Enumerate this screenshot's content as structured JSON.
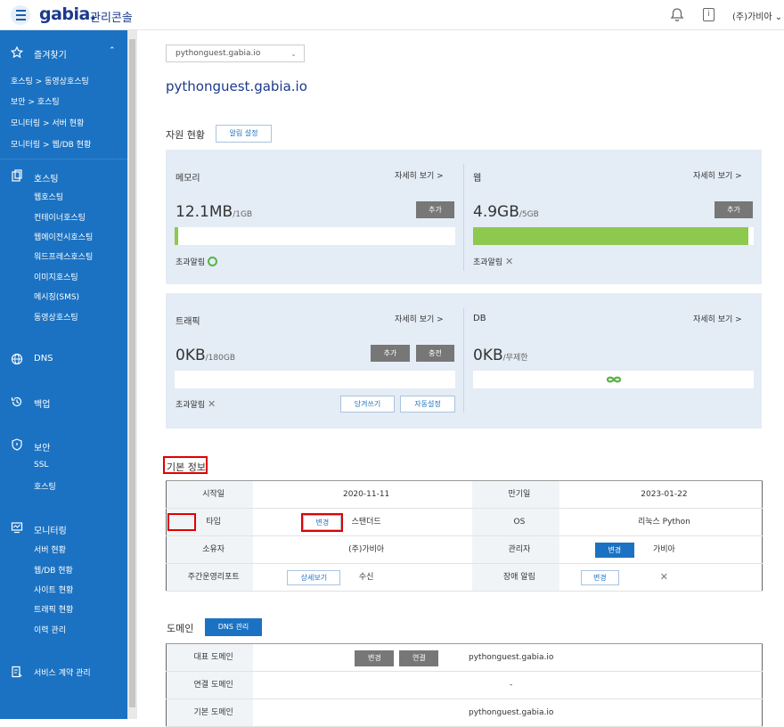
{
  "header": {
    "logo": "gabia.",
    "console_label": "관리콘솔",
    "user_name": "(주)가비아"
  },
  "sidebar": {
    "favorites": {
      "title": "즐겨찾기",
      "items": [
        "호스팅 > 동영상호스팅",
        "보안 > 호스팅",
        "모니터링 > 서버 현황",
        "모니터링 > 웹/DB 현황"
      ]
    },
    "hosting": {
      "title": "호스팅",
      "items": [
        "웹호스팅",
        "컨테이너호스팅",
        "웹에이전시호스팅",
        "워드프레스호스팅",
        "이미지호스팅",
        "메시징(SMS)",
        "동영상호스팅"
      ]
    },
    "dns": {
      "title": "DNS"
    },
    "backup": {
      "title": "백업"
    },
    "security": {
      "title": "보안",
      "items": [
        "SSL",
        "호스팅"
      ]
    },
    "monitoring": {
      "title": "모니터링",
      "items": [
        "서버 현황",
        "웹/DB 현황",
        "사이트 현황",
        "트래픽 현황",
        "이력 관리"
      ]
    },
    "contract": {
      "title": "서비스 계약 관리"
    }
  },
  "main": {
    "domain_select_value": "pythonguest.gabia.io",
    "domain_title": "pythonguest.gabia.io",
    "resources": {
      "title": "자원 현황",
      "alert_setting_button": "알림 설정",
      "detail_link": "자세히 보기 >",
      "alert_label": "초과알림",
      "memory": {
        "title": "메모리",
        "value": "12.1MB",
        "limit": "/1GB",
        "add": "추가",
        "usage_fraction": 0.012,
        "alert": "on"
      },
      "web": {
        "title": "웹",
        "value": "4.9GB",
        "limit": "/5GB",
        "add": "추가",
        "usage_fraction": 0.98,
        "alert": "off"
      },
      "traffic": {
        "title": "트래픽",
        "value": "0KB",
        "limit": "/180GB",
        "add": "추가",
        "charge": "충전",
        "usage_fraction": 0,
        "alert": "off",
        "pull_button": "당겨쓰기",
        "auto_button": "자동설정"
      },
      "db": {
        "title": "DB",
        "value": "0KB",
        "limit": "/무제한"
      }
    },
    "basic_info": {
      "title": "기본 정보",
      "rows": [
        {
          "l1": "시작일",
          "v1": "2020-11-11",
          "l2": "만기일",
          "v2": "2023-01-22"
        },
        {
          "l1": "타입",
          "v1": "스탠더드",
          "b1": "변경",
          "l2": "OS",
          "v2": "리눅스 Python"
        },
        {
          "l1": "소유자",
          "v1": "(주)가비아",
          "l2": "관리자",
          "v2": "가비아",
          "b2": "변경"
        },
        {
          "l1": "주간운영리포트",
          "v1": "수신",
          "b1": "상세보기",
          "l2": "장애 알림",
          "b2": "변경"
        }
      ]
    },
    "domain": {
      "title": "도메인",
      "dns_button": "DNS 관리",
      "rows": [
        {
          "label": "대표 도메인",
          "value": "pythonguest.gabia.io",
          "b1": "변경",
          "b2": "연결"
        },
        {
          "label": "연결 도메인",
          "value": "-"
        },
        {
          "label": "기본 도메인",
          "value": "pythonguest.gabia.io"
        }
      ]
    }
  },
  "colors": {
    "sidebar": "#1b72c2",
    "panel": "#e4ecf5",
    "bar_fill": "#8dc94e",
    "highlight": "#e00000"
  }
}
